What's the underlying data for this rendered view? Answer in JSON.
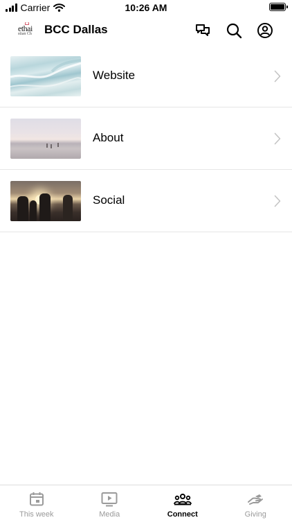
{
  "status_bar": {
    "carrier": "Carrier",
    "time": "10:26 AM"
  },
  "header": {
    "logo_text_main": "ethai",
    "logo_text_sub": "stian Ch",
    "title": "BCC Dallas",
    "icons": [
      "chat-bubbles-icon",
      "search-icon",
      "account-icon"
    ]
  },
  "list": {
    "items": [
      {
        "label": "Website",
        "thumbnail": "ocean-waves"
      },
      {
        "label": "About",
        "thumbnail": "beach-sunrise"
      },
      {
        "label": "Social",
        "thumbnail": "friends-sunset"
      }
    ]
  },
  "tabbar": {
    "tabs": [
      {
        "label": "This week",
        "icon": "calendar-icon",
        "active": false
      },
      {
        "label": "Media",
        "icon": "play-icon",
        "active": false
      },
      {
        "label": "Connect",
        "icon": "people-icon",
        "active": true
      },
      {
        "label": "Giving",
        "icon": "giving-hand-icon",
        "active": false
      }
    ]
  },
  "colors": {
    "active_tab": "#000000",
    "inactive_tab": "#9a9a9a",
    "divider": "#e6e6e6",
    "chevron": "#c4c4c4"
  }
}
